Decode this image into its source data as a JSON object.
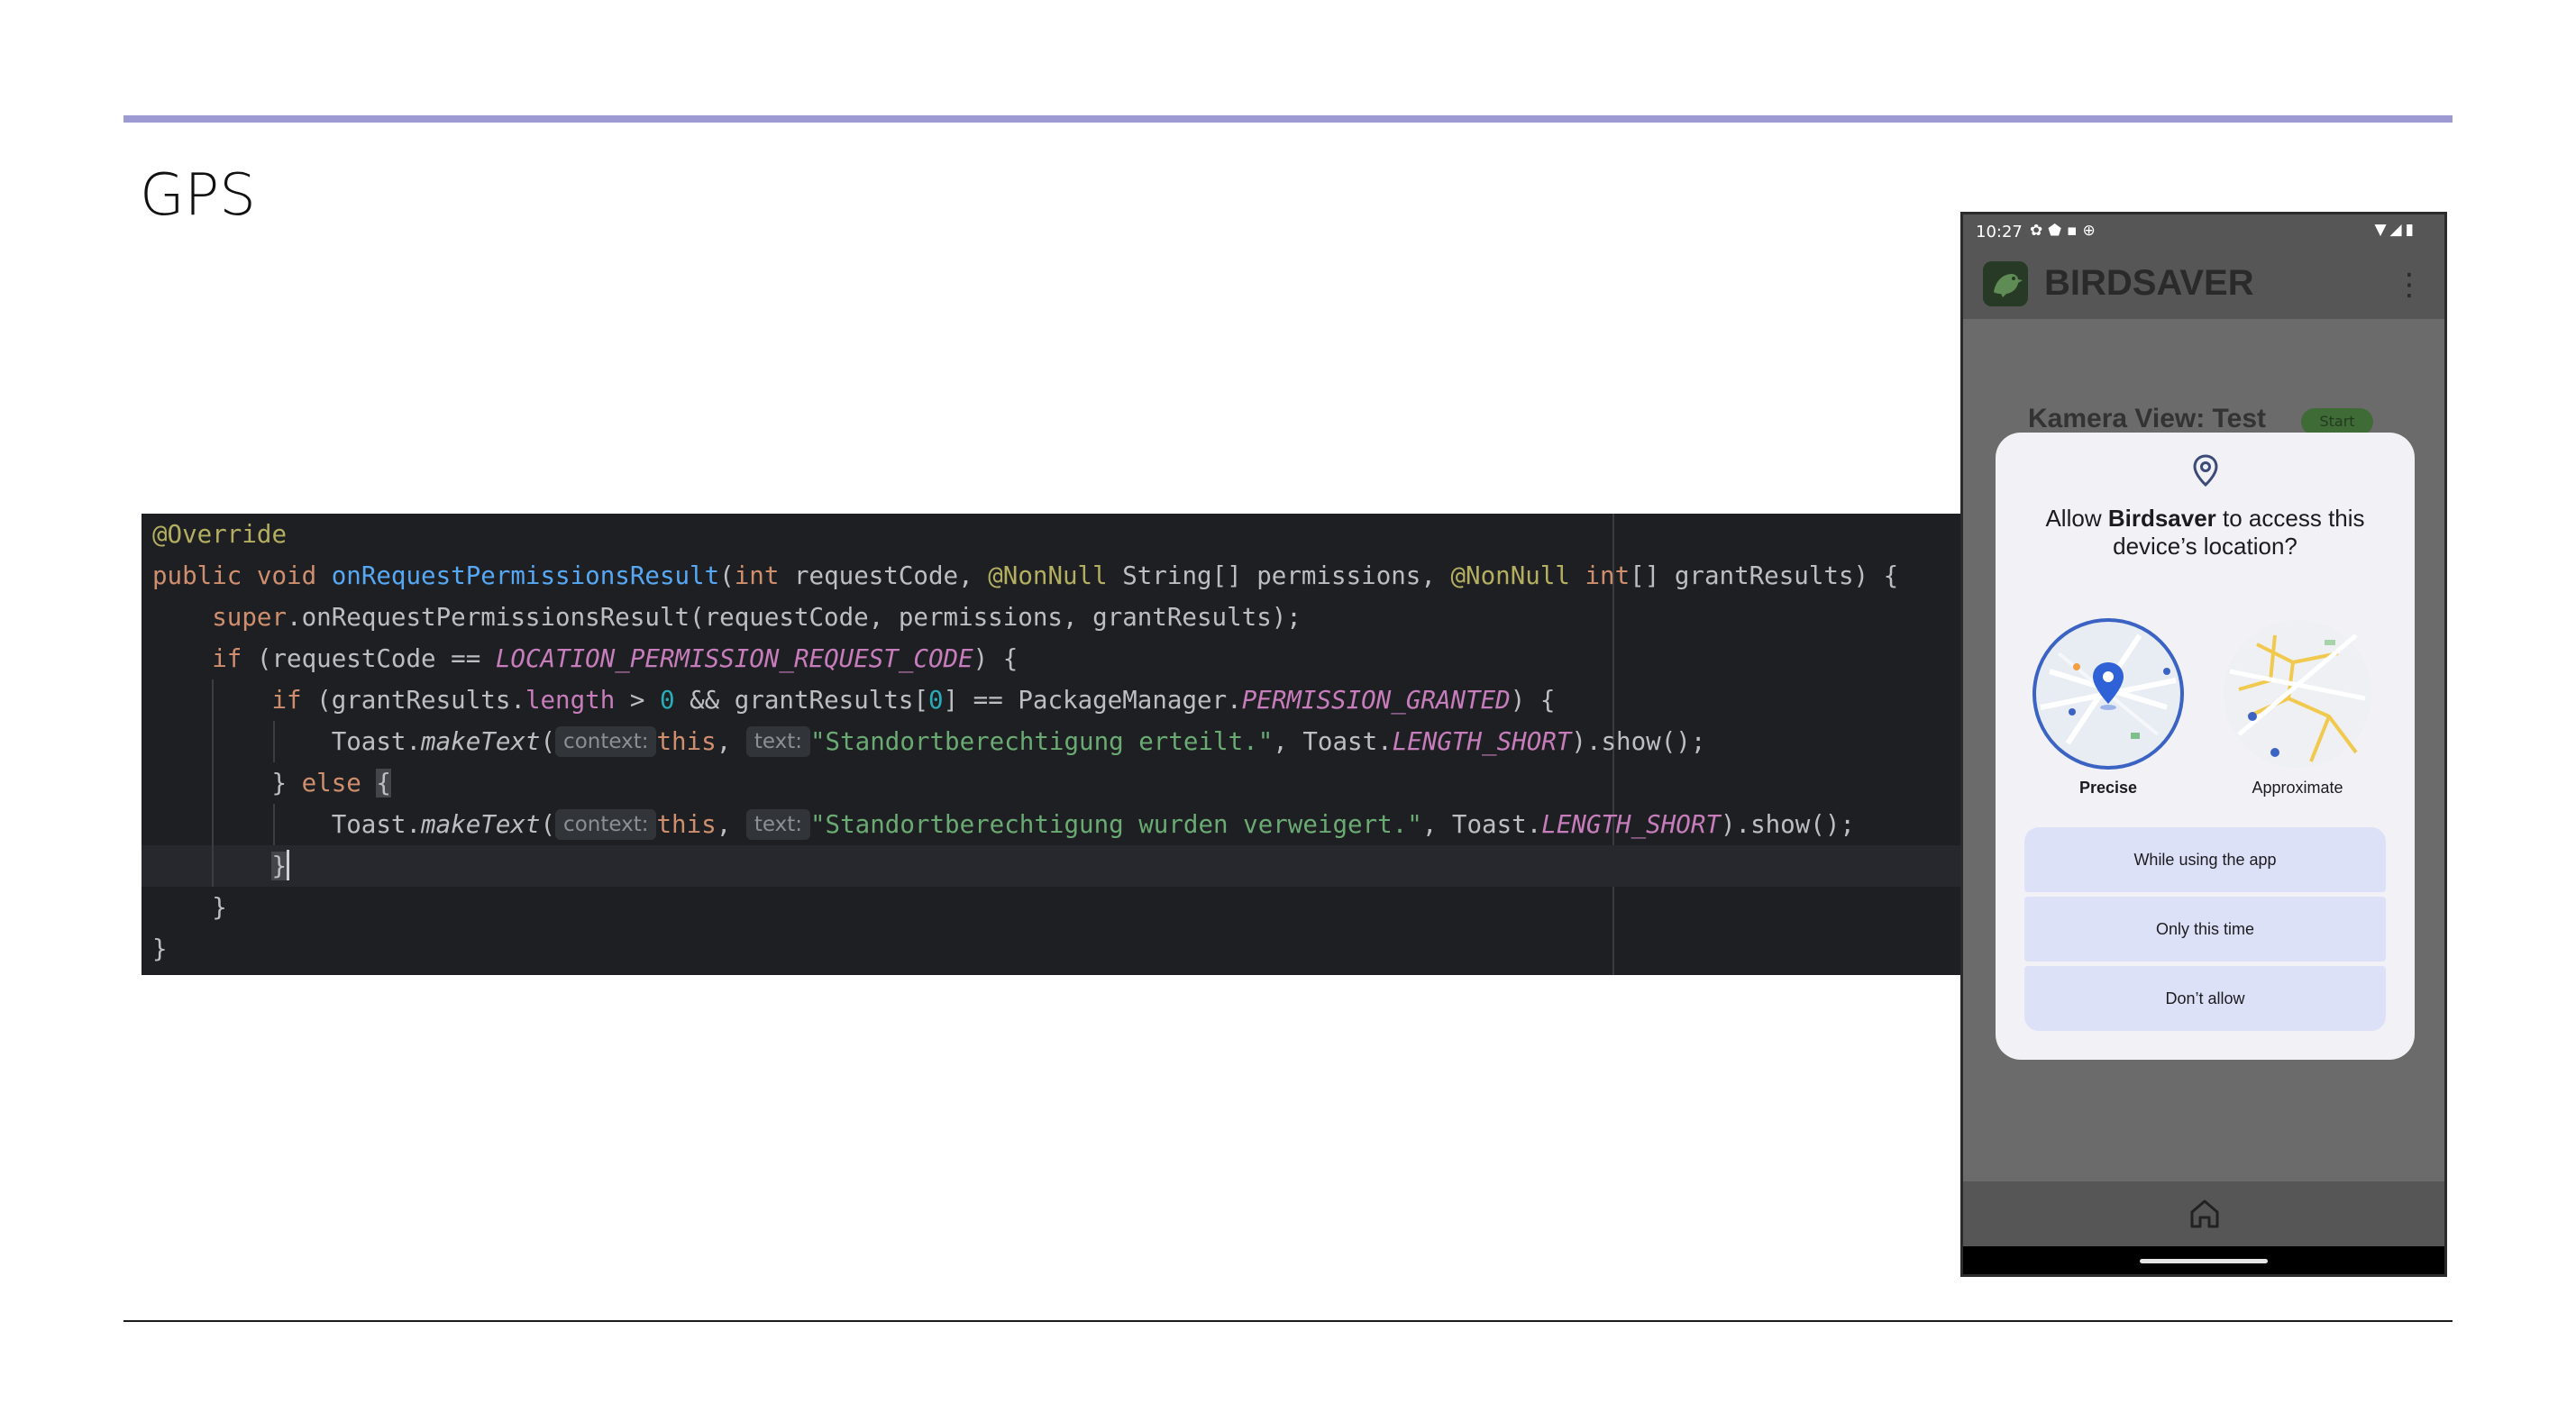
{
  "slide": {
    "title": "GPS"
  },
  "code": {
    "l1_annotation": "@Override",
    "l2_public": "public",
    "l2_void": "void",
    "l2_method": "onRequestPermissionsResult",
    "l2_int": "int",
    "l2_requestCode": "requestCode,",
    "l2_nonnull1": "@NonNull",
    "l2_string": "String[] permissions,",
    "l2_nonnull2": "@NonNull",
    "l2_int2": "int",
    "l2_tail": "[] grantResults) {",
    "l3_super": "super",
    "l3_rest": ".onRequestPermissionsResult(requestCode, permissions, grantResults);",
    "l4_if": "if",
    "l4_open": "(requestCode ==",
    "l4_const": "LOCATION_PERMISSION_REQUEST_CODE",
    "l4_close": ") {",
    "l5_if": "if",
    "l5_a": "(grantResults.",
    "l5_length": "length",
    "l5_gt": ">",
    "l5_zero": "0",
    "l5_b": "&& grantResults[",
    "l5_idx": "0",
    "l5_c": "] == PackageManager.",
    "l5_const": "PERMISSION_GRANTED",
    "l5_close": ") {",
    "l6_toast": "Toast.",
    "l6_maketext": "makeText",
    "l6_paren": "(",
    "hint_context": "context:",
    "hint_text": "text:",
    "this_kw": "this",
    "l6_string": "\"Standortberechtigung erteilt.\"",
    "l6_toast2": ", Toast.",
    "length_short": "LENGTH_SHORT",
    "show_call": ").show();",
    "l7_brace": "}",
    "l7_else": "else",
    "l7_open": "{",
    "l8_string": "\"Standortberechtigung wurden verweigert.\"",
    "l9_brace": "}",
    "l10_brace": "}",
    "l11_brace": "}"
  },
  "phone": {
    "status_time": "10:27",
    "status_left_icons": "✿⬟▪⊕",
    "status_right_icons": "▼◢▮",
    "app_title": "BIRDSAVER",
    "app_menu": "⋮",
    "bg_label": "Kamera View:  Test",
    "bg_button": "Start",
    "dialog": {
      "title_prefix": "Allow ",
      "app_name": "Birdsaver",
      "title_suffix": " to access this device’s location?",
      "precise_label": "Precise",
      "approximate_label": "Approximate",
      "btn_while_using": "While using the app",
      "btn_only_this_time": "Only this time",
      "btn_dont_allow": "Don’t allow"
    },
    "colors": {
      "accent": "#3b63c4",
      "button_bg": "#dde1f8",
      "dialog_bg": "#f1f1f6"
    },
    "icons": [
      "location-pin-icon",
      "home-icon",
      "overflow-menu-icon",
      "bird-logo-icon"
    ]
  }
}
